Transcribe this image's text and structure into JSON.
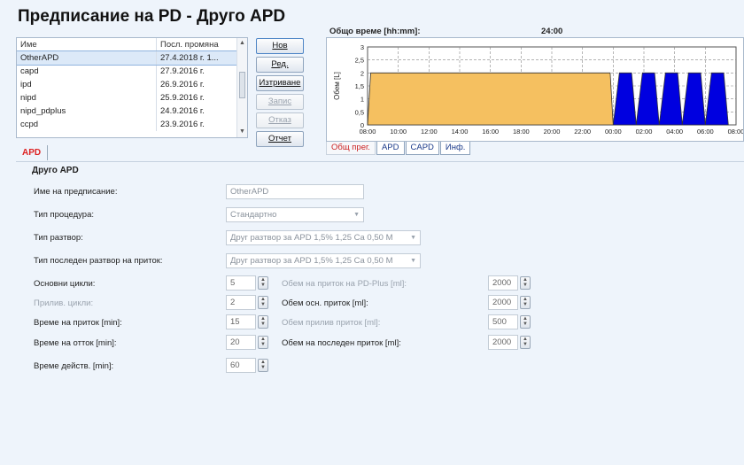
{
  "title": "Предписание на PD - Друго APD",
  "list": {
    "headers": [
      "Име",
      "Посл. промяна"
    ],
    "rows": [
      {
        "name": "OtherAPD",
        "date": "27.4.2018 г. 1..."
      },
      {
        "name": "capd",
        "date": "27.9.2016 г."
      },
      {
        "name": "ipd",
        "date": "26.9.2016 г."
      },
      {
        "name": "nipd",
        "date": "25.9.2016 г."
      },
      {
        "name": "nipd_pdplus",
        "date": "24.9.2016 г."
      },
      {
        "name": "ccpd",
        "date": "23.9.2016 г."
      }
    ],
    "selected_index": 0
  },
  "buttons": {
    "new": "Нов",
    "edit": "Ред.",
    "delete": "Изтриване",
    "save": "Запис",
    "cancel": "Отказ",
    "report": "Отчет"
  },
  "chart_header": {
    "label": "Общо време [hh:mm]:",
    "value": "24:00"
  },
  "chart_data": {
    "type": "area",
    "ylabel": "Обем [L]",
    "ylim": [
      0,
      3
    ],
    "yticks": [
      "3",
      "2,5",
      "2",
      "1,5",
      "1",
      "0,5",
      "0"
    ],
    "xticks": [
      "08:00",
      "10:00",
      "12:00",
      "14:00",
      "16:00",
      "18:00",
      "20:00",
      "22:00",
      "00:00",
      "02:00",
      "04:00",
      "06:00",
      "08:00"
    ],
    "series": [
      {
        "color": "#f5c060",
        "values": [
          [
            0,
            0
          ],
          [
            0.2,
            2
          ],
          [
            15.8,
            2
          ],
          [
            16,
            0
          ]
        ]
      },
      {
        "color": "#0000e0",
        "values": [
          [
            16,
            0
          ],
          [
            16.4,
            2
          ],
          [
            17.2,
            2
          ],
          [
            17.5,
            0
          ],
          [
            17.9,
            2
          ],
          [
            18.7,
            2
          ],
          [
            19,
            0
          ],
          [
            19.4,
            2
          ],
          [
            20.2,
            2
          ],
          [
            20.5,
            0
          ],
          [
            20.9,
            2
          ],
          [
            21.7,
            2
          ],
          [
            22,
            0
          ],
          [
            22.4,
            2
          ],
          [
            23.2,
            2
          ],
          [
            23.5,
            0
          ]
        ]
      }
    ],
    "grid": true
  },
  "chart_tabs": [
    "Общ прег.",
    "APD",
    "CAPD",
    "Инф."
  ],
  "main_tab": "APD",
  "section_title": "Друго APD",
  "form": {
    "name_label": "Име на предписание:",
    "name_value": "OtherAPD",
    "proc_label": "Тип процедура:",
    "proc_value": "Стандартно",
    "sol_label": "Тип разтвор:",
    "sol_value": "Друг разтвор за APD 1,5% 1,25 Ca 0,50 M",
    "last_sol_label": "Тип последен разтвор на приток:",
    "last_sol_value": "Друг разтвор за APD 1,5% 1,25 Ca 0,50 M",
    "base_cycles_label": "Основни цикли:",
    "base_cycles_value": "5",
    "tidal_cycles_label": "Прилив. цикли:",
    "tidal_cycles_value": "2",
    "inflow_time_label": "Време на приток [min]:",
    "inflow_time_value": "15",
    "outflow_time_label": "Време на отток [min]:",
    "outflow_time_value": "20",
    "dwell_time_label": "Време действ. [min]:",
    "dwell_time_value": "60",
    "pdplus_vol_label": "Обем на приток на PD-Plus [ml]:",
    "pdplus_vol_value": "2000",
    "base_vol_label": "Обем осн. приток [ml]:",
    "base_vol_value": "2000",
    "tidal_vol_label": "Обем прилив приток [ml]:",
    "tidal_vol_value": "500",
    "last_vol_label": "Обем на последен приток [ml]:",
    "last_vol_value": "2000"
  }
}
